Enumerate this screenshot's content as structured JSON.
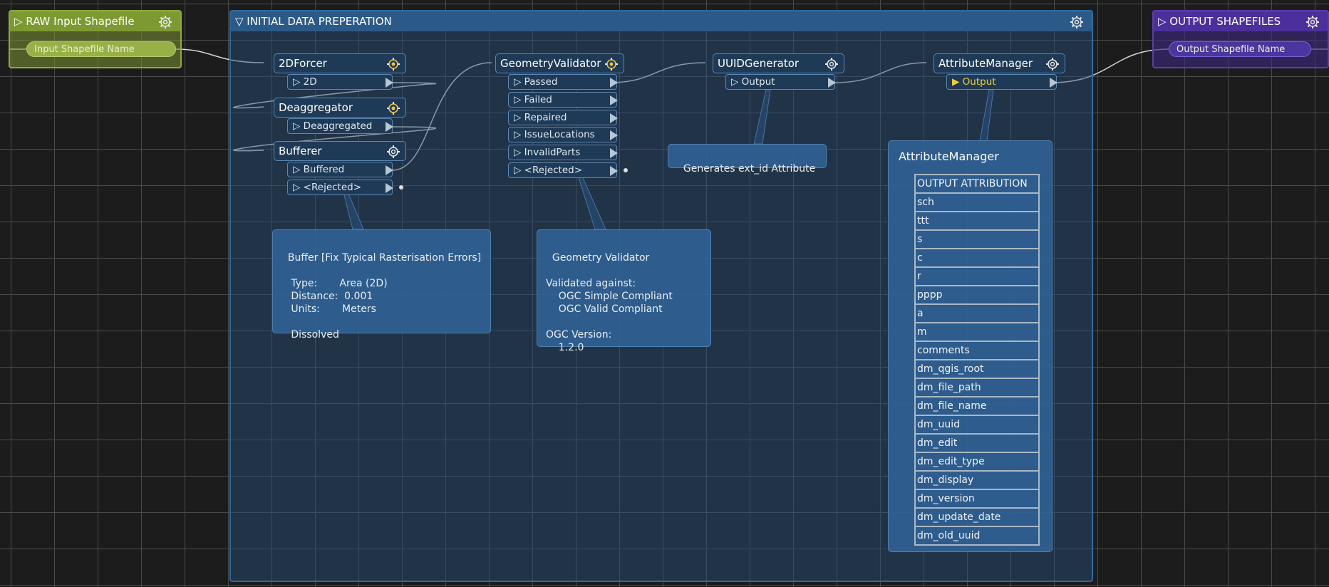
{
  "bookmarks": {
    "raw": {
      "title": "▷ RAW Input Shapefile",
      "port": "Input Shapefile Name"
    },
    "initial": {
      "title": "▽ INITIAL DATA PREPERATION"
    },
    "output": {
      "title": "▷ OUTPUT SHAPEFILES",
      "port": "Output Shapefile Name"
    }
  },
  "transformers": {
    "forcer": {
      "name": "2DForcer",
      "ports": [
        "▷ 2D"
      ]
    },
    "deagg": {
      "name": "Deaggregator",
      "ports": [
        "▷ Deaggregated"
      ]
    },
    "bufferer": {
      "name": "Bufferer",
      "ports": [
        "▷ Buffered",
        "▷ <Rejected>"
      ]
    },
    "geomval": {
      "name": "GeometryValidator",
      "ports": [
        "▷ Passed",
        "▷ Failed",
        "▷ Repaired",
        "▷ IssueLocations",
        "▷ InvalidParts",
        "▷ <Rejected>"
      ]
    },
    "uuid": {
      "name": "UUIDGenerator",
      "ports": [
        "▷ Output"
      ]
    },
    "attrman": {
      "name": "AttributeManager",
      "ports": [
        "▶ Output"
      ]
    }
  },
  "annotations": {
    "buffer": "Buffer [Fix Typical Rasterisation Errors]\n\n   Type:       Area (2D)\n   Distance:  0.001\n   Units:       Meters\n\n   Dissolved",
    "geomval": "Geometry Validator\n\nValidated against:\n    OGC Simple Compliant\n    OGC Valid Compliant\n\nOGC Version:\n    1.2.0",
    "uuid": "Generates ext_id Attribute"
  },
  "attribute_panel": {
    "title": "AttributeManager",
    "rows": [
      "OUTPUT ATTRIBUTION",
      "sch",
      "ttt",
      "s",
      "c",
      "r",
      "pppp",
      "a",
      "m",
      "comments",
      "dm_qgis_root",
      "dm_file_path",
      "dm_file_name",
      "dm_uuid",
      "dm_edit",
      "dm_edit_type",
      "dm_display",
      "dm_version",
      "dm_update_date",
      "dm_old_uuid"
    ]
  },
  "colors": {
    "canvas": "#1c1c1c",
    "raw_bookmark": "#7d9a32",
    "initial_bookmark": "#2c5a88",
    "output_bookmark": "#4b2f9a",
    "transformer": "#1f3a56",
    "annotation": "#30629a"
  },
  "icons": {
    "gear": "gear-icon",
    "port_arrow": "output-port-arrow",
    "expand": "triangle-expand-icon"
  }
}
